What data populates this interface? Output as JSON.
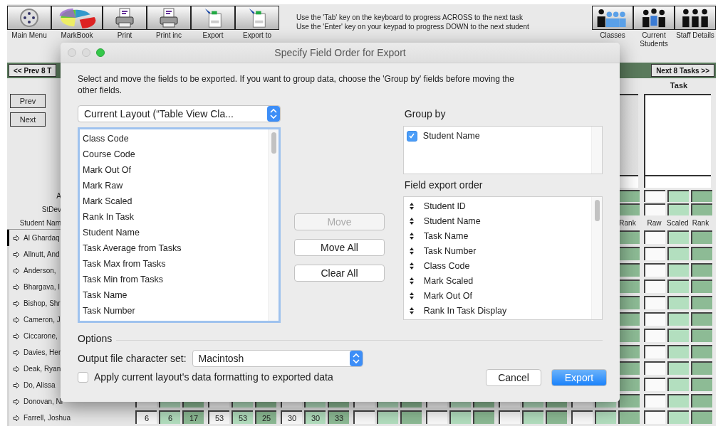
{
  "toolbar": {
    "left_buttons": [
      {
        "label": "Main Menu",
        "kind": "menu"
      },
      {
        "label": "MarkBook",
        "kind": "pie"
      },
      {
        "label": "Print",
        "kind": "print"
      },
      {
        "label": "Print inc",
        "kind": "print"
      },
      {
        "label": "Export",
        "kind": "xls"
      },
      {
        "label": "Export to",
        "kind": "xls"
      }
    ],
    "hints": [
      "Use the 'Tab' key on the keyboard to progress ACROSS to the next task",
      "Use the 'Enter' key on your keypad to progress DOWN to the next student"
    ],
    "right_buttons": [
      {
        "label": "Classes",
        "kind": "group"
      },
      {
        "label": "Current Students",
        "kind": "students"
      },
      {
        "label": "Staff Details",
        "kind": "staff"
      }
    ]
  },
  "nav": {
    "prev": "<< Prev 8 T",
    "next": "Next 8 Tasks >>"
  },
  "side": {
    "buttons": [
      "Prev",
      "Next"
    ],
    "stat_labels": [
      "A",
      "StDev"
    ],
    "name_header": "Student Nam"
  },
  "tasks": [
    {
      "headers": [
        "Rank"
      ]
    },
    {
      "title": "Task",
      "headers": [
        "Raw",
        "Scaled",
        "Rank"
      ]
    }
  ],
  "students": [
    {
      "name": "Al Ghardaq",
      "selected": true
    },
    {
      "name": "Allnutt, And",
      "selected": false
    },
    {
      "name": "Anderson, ",
      "selected": false
    },
    {
      "name": "Bhargava, I",
      "selected": false
    },
    {
      "name": "Bishop, Shr",
      "selected": false
    },
    {
      "name": "Cameron, J",
      "selected": false
    },
    {
      "name": "Ciccarone,",
      "selected": false
    },
    {
      "name": "Davies, Her",
      "selected": false
    },
    {
      "name": "Deak, Ryan",
      "selected": false
    },
    {
      "name": "Do, Alissa",
      "selected": false
    },
    {
      "name": "Donovan, Ni",
      "selected": false
    },
    {
      "name": "Farrell, Joshua",
      "selected": false,
      "marks": [
        "6",
        "6",
        "17",
        "53",
        "53",
        "25",
        "30",
        "30",
        "33"
      ]
    }
  ],
  "dialog": {
    "title": "Specify Field Order for Export",
    "instructions": "Select and move the fields to be exported.  If you want to group data, choose the 'Group by' fields before moving the other fields.",
    "layout_select": "Current Layout (“Table View Cla...",
    "available_fields": [
      "Class Code",
      "Course Code",
      "Mark Out Of",
      "Mark Raw",
      "Mark Scaled",
      "Rank In Task",
      "Student Name",
      "Task Average from Tasks",
      "Task Max from Tasks",
      "Task Min from Tasks",
      "Task Name",
      "Task Number"
    ],
    "buttons": [
      {
        "label": "Move",
        "disabled": true
      },
      {
        "label": "Move All",
        "disabled": false
      },
      {
        "label": "Clear All",
        "disabled": false
      }
    ],
    "group_by": {
      "label": "Group by",
      "items": [
        {
          "label": "Student Name",
          "checked": true
        }
      ]
    },
    "export_order": {
      "label": "Field export order",
      "items": [
        "Student ID",
        "Student Name",
        "Task Name",
        "Task Number",
        "Class Code",
        "Mark Scaled",
        "Mark Out Of",
        "Rank In Task Display"
      ]
    },
    "options": {
      "label": "Options",
      "charset_label": "Output file character set:",
      "charset": "Macintosh",
      "apply_formatting": {
        "label": "Apply current layout's data formatting to exported data",
        "checked": false
      }
    },
    "actions": [
      {
        "label": "Cancel",
        "kind": "default"
      },
      {
        "label": "Export",
        "kind": "primary"
      }
    ]
  }
}
